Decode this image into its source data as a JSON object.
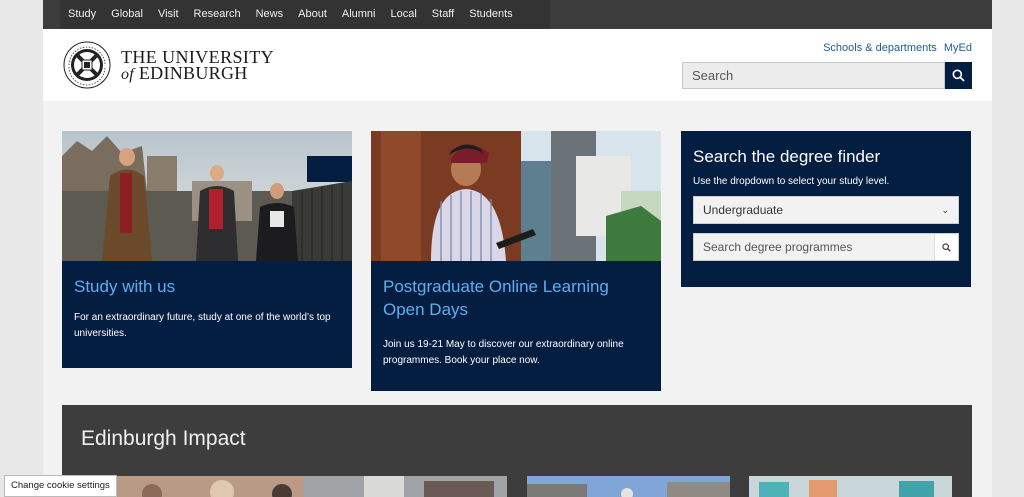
{
  "topnav": {
    "items": [
      {
        "label": "Study"
      },
      {
        "label": "Global"
      },
      {
        "label": "Visit"
      },
      {
        "label": "Research"
      },
      {
        "label": "News"
      },
      {
        "label": "About"
      },
      {
        "label": "Alumni"
      },
      {
        "label": "Local"
      },
      {
        "label": "Staff"
      },
      {
        "label": "Students"
      }
    ]
  },
  "header": {
    "logo_line1": "THE UNIVERSITY",
    "logo_line2_of": "of",
    "logo_line2_name": "EDINBURGH",
    "links": [
      {
        "label": "Schools & departments"
      },
      {
        "label": "MyEd"
      }
    ],
    "search_placeholder": "Search",
    "search_icon": "search-icon"
  },
  "cards": [
    {
      "title": "Study with us",
      "text": "For an extraordinary future, study at one of the world’s top universities."
    },
    {
      "title": "Postgraduate Online Learning Open Days",
      "text": "Join us 19-21 May to discover our extraordinary online programmes. Book your place now."
    }
  ],
  "finder": {
    "title": "Search the degree finder",
    "hint": "Use the dropdown to select your study level.",
    "level_selected": "Undergraduate",
    "search_placeholder": "Search degree programmes"
  },
  "impact": {
    "title": "Edinburgh Impact"
  },
  "cookie": {
    "label": "Change cookie settings"
  },
  "colors": {
    "navy": "#041e42",
    "link_blue": "#1f5c99",
    "card_title_blue": "#5ab0f2",
    "nav_dark": "#333333"
  }
}
